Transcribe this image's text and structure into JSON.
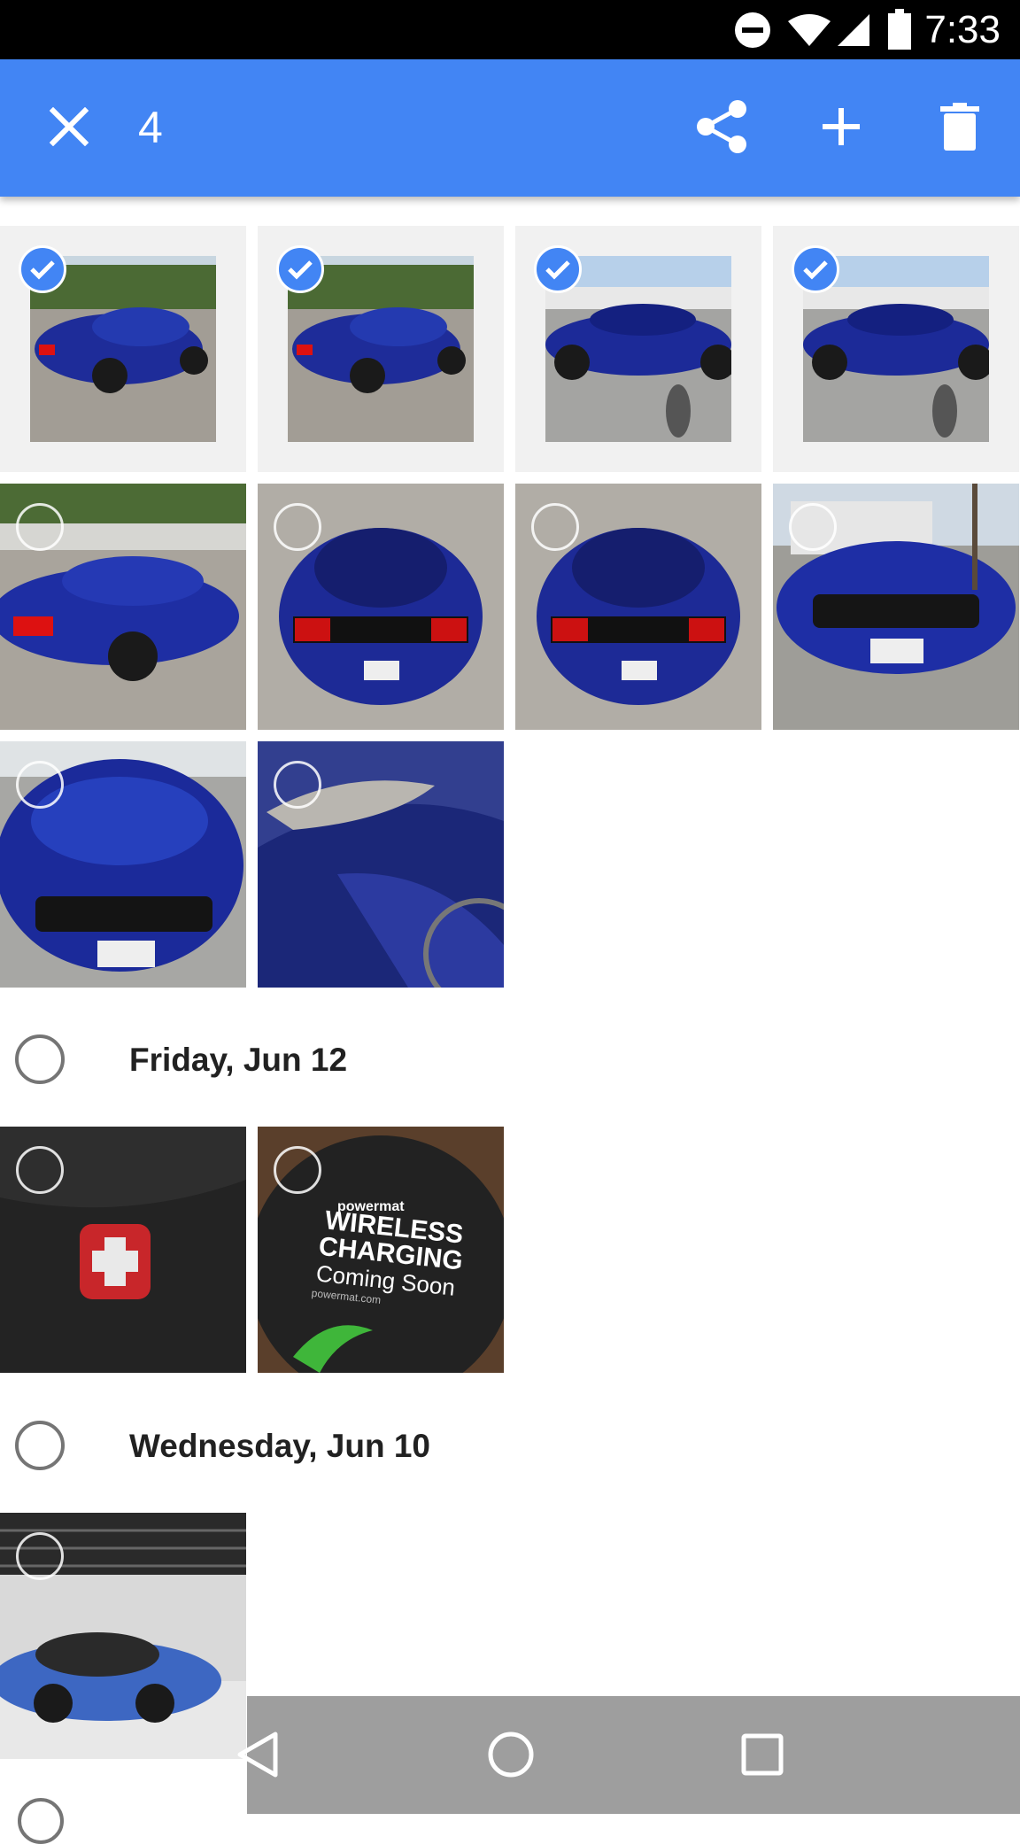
{
  "status_bar": {
    "time": "7:33",
    "icons": [
      "do-not-disturb-icon",
      "wifi-icon",
      "signal-icon",
      "battery-icon"
    ]
  },
  "action_bar": {
    "selected_count": "4",
    "buttons": [
      "close-icon",
      "share-icon",
      "add-icon",
      "delete-icon"
    ],
    "background": "#4285f4"
  },
  "sections": [
    {
      "date": "",
      "photos": [
        {
          "subject": "blue mustang rear three-quarter",
          "selected": true
        },
        {
          "subject": "blue mustang rear three-quarter",
          "selected": true
        },
        {
          "subject": "blue mustang side view",
          "selected": true
        },
        {
          "subject": "blue mustang side view",
          "selected": true
        },
        {
          "subject": "blue mustang rear angle",
          "selected": false
        },
        {
          "subject": "blue mustang rear",
          "selected": false
        },
        {
          "subject": "blue mustang rear",
          "selected": false
        },
        {
          "subject": "blue mustang front",
          "selected": false
        },
        {
          "subject": "blue mustang front close",
          "selected": false
        },
        {
          "subject": "blue mustang headlight close-up",
          "selected": false
        }
      ]
    },
    {
      "date": "Friday, Jun 12",
      "photos": [
        {
          "subject": "backpack badge",
          "selected": false
        },
        {
          "subject": "wireless charging pad",
          "selected": false
        }
      ]
    },
    {
      "date": "Wednesday, Jun 10",
      "photos": [
        {
          "subject": "blue hatchback in garage",
          "selected": false
        }
      ]
    }
  ],
  "photo_text": {
    "brand": "powermat",
    "line1": "WIRELESS",
    "line2": "CHARGING",
    "line3": "Coming Soon",
    "url": "powermat.com"
  },
  "nav_bar": {
    "buttons": [
      "back-icon",
      "home-icon",
      "recents-icon"
    ]
  },
  "colors": {
    "accent": "#4285f4",
    "car_blue": "#1f2f9e",
    "nav_bg": "#9e9e9e"
  }
}
